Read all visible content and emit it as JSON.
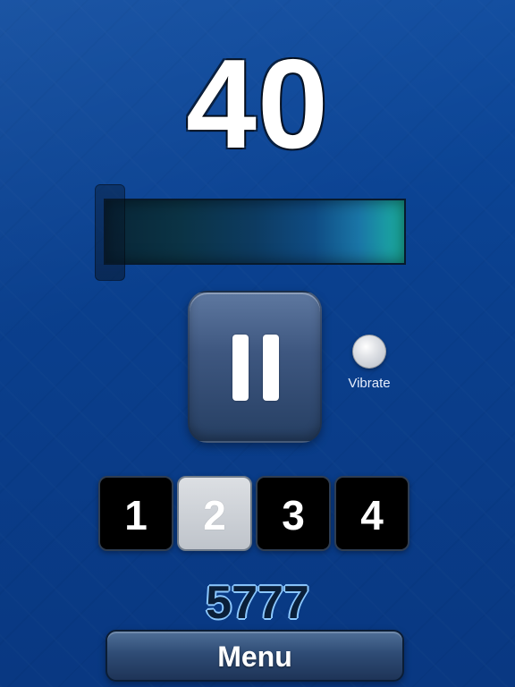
{
  "app": {
    "counter_value": "40",
    "meter": {
      "fill_fraction": 1.0,
      "needle_level_fraction": 0.0
    },
    "controls": {
      "pause_icon": "pause-icon",
      "vibrate": {
        "label": "Vibrate",
        "state": "off"
      }
    },
    "selector": {
      "options": [
        "1",
        "2",
        "3",
        "4"
      ],
      "selected": "2"
    },
    "score_value": "5777",
    "menu": {
      "label": "Menu"
    }
  }
}
